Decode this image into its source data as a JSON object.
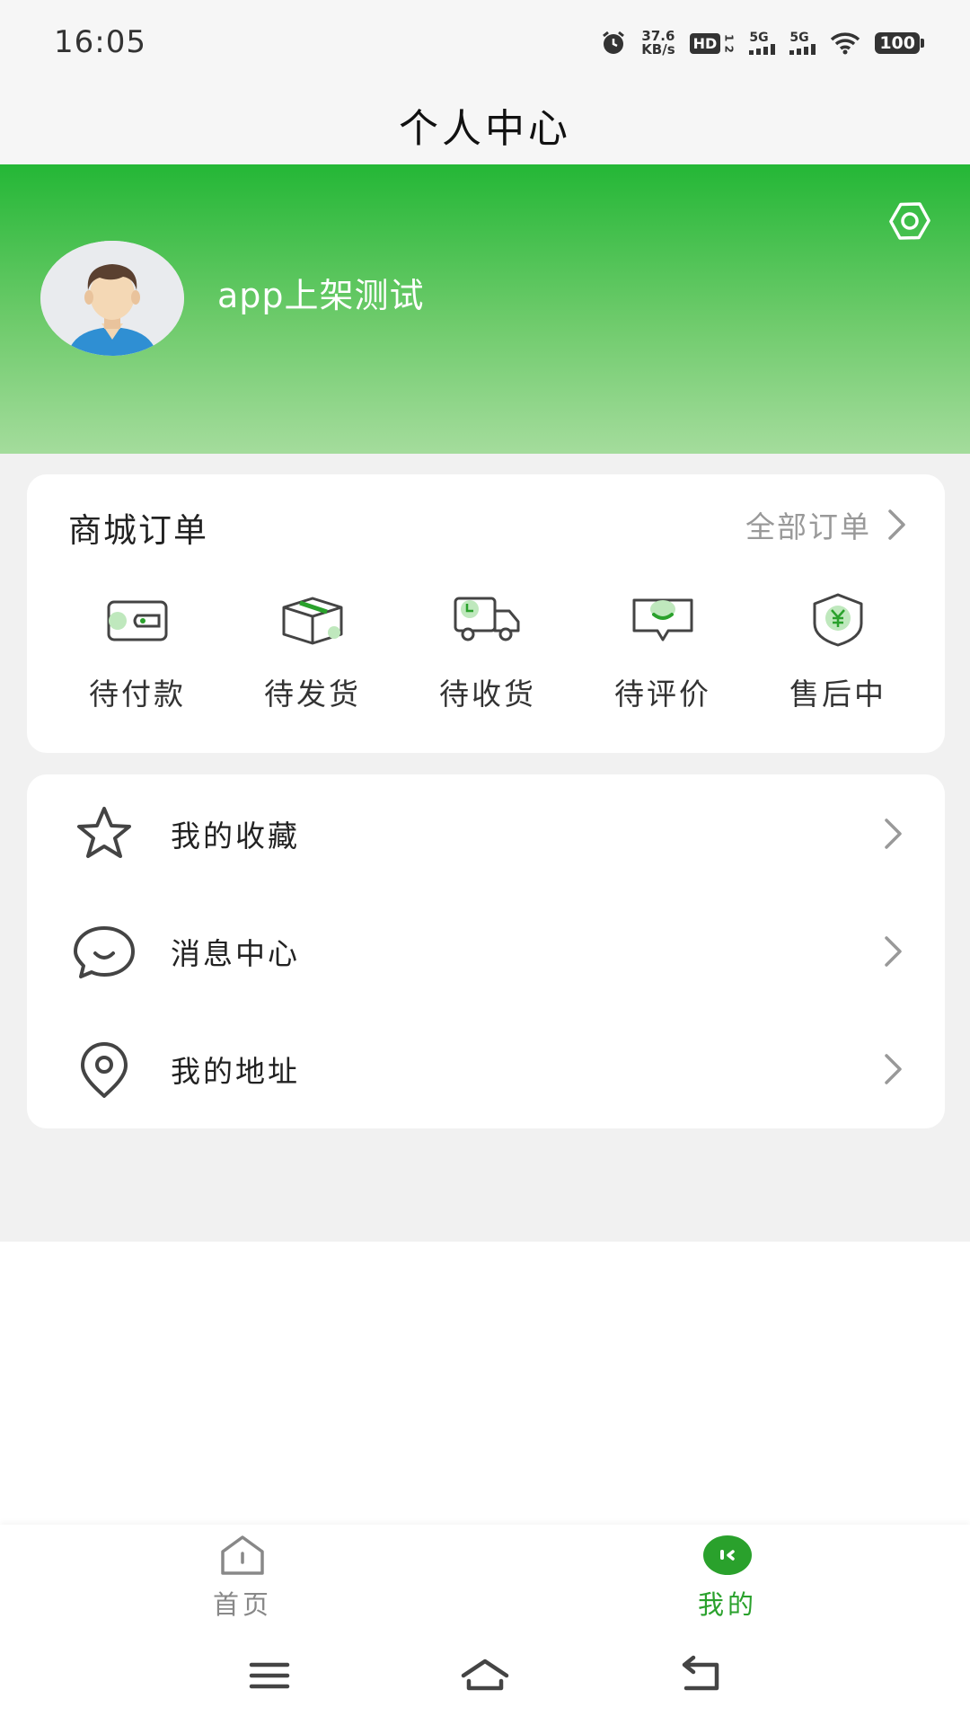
{
  "status_bar": {
    "time": "16:05",
    "net_speed_value": "37.6",
    "net_speed_unit": "KB/s",
    "hd_label": "HD",
    "hd_sub": "1 2",
    "signal1_label": "5G",
    "signal2_label": "5G",
    "battery": "100",
    "icons": [
      "alarm-icon",
      "hd-icon",
      "signal-icon",
      "signal-icon",
      "wifi-icon",
      "battery-icon"
    ]
  },
  "title_bar": {
    "title": "个人中心"
  },
  "profile": {
    "username": "app上架测试",
    "icons": [
      "settings-icon",
      "avatar"
    ]
  },
  "orders": {
    "title": "商城订单",
    "all_orders_label": "全部订单",
    "items": [
      {
        "label": "待付款",
        "icon": "wallet-icon"
      },
      {
        "label": "待发货",
        "icon": "package-icon"
      },
      {
        "label": "待收货",
        "icon": "truck-icon"
      },
      {
        "label": "待评价",
        "icon": "review-icon"
      },
      {
        "label": "售后中",
        "icon": "after-sale-shield-icon"
      }
    ]
  },
  "menu": {
    "items": [
      {
        "label": "我的收藏",
        "icon": "star-icon"
      },
      {
        "label": "消息中心",
        "icon": "message-icon"
      },
      {
        "label": "我的地址",
        "icon": "location-icon"
      }
    ]
  },
  "bottom_nav": {
    "items": [
      {
        "label": "首页",
        "icon": "home-icon",
        "active": false
      },
      {
        "label": "我的",
        "icon": "profile-face-icon",
        "active": true
      }
    ]
  },
  "colors": {
    "accent_green": "#2aa12c",
    "header_gradient_top": "#24b736",
    "header_gradient_bottom": "#a4dc9c",
    "background_grey": "#f1f1f1"
  }
}
